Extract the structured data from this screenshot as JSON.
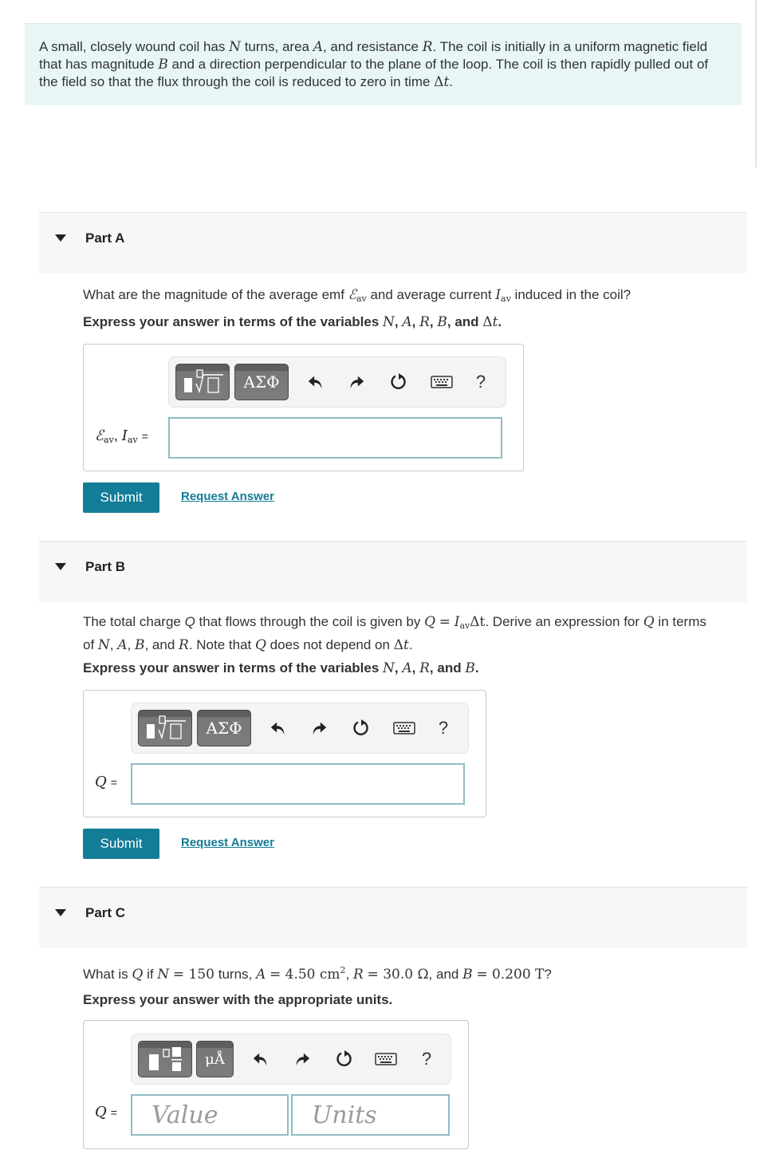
{
  "intro": {
    "text_html": "A small, closely wound coil has <span class=\"math\">N</span> turns, area <span class=\"math\">A</span>, and resistance <span class=\"math\">R</span>. The coil is initially in a uniform magnetic field that has magnitude <span class=\"math\">B</span> and a direction perpendicular to the plane of the loop. The coil is then rapidly pulled out of the field so that the flux through the coil is reduced to zero in time <span class=\"mathr\">&Delta;</span><span class=\"math\">t</span>."
  },
  "parts": [
    {
      "title": "Part A",
      "question_html": "What are the magnitude of the average emf <span class=\"math\">&#8496;</span><sub class=\"ms\">av</sub> and average current <span class=\"math\">I</span><sub class=\"ms\">av</sub> induced in the coil?",
      "instruction_html": "Express your answer in terms of the variables <span class=\"math\" style=\"font-weight:normal\">N</span>, <span class=\"math\" style=\"font-weight:normal\">A</span>, <span class=\"math\" style=\"font-weight:normal\">R</span>, <span class=\"math\" style=\"font-weight:normal\">B</span>, and <span class=\"mathr\" style=\"font-weight:normal\">&Delta;</span><span class=\"math\" style=\"font-weight:normal\">t</span>.",
      "answer_label_html": "<span class=\"math\">&#8496;</span><sub class=\"ms\">av</sub>, <span class=\"math\">I</span><sub class=\"ms\">av</sub> <span style=\"font-family:'Liberation Sans',sans-serif;font-size:14px\">=</span>",
      "answer_value": "",
      "toolbar": {
        "template_button": "templates",
        "greek_button": "ΑΣΦ",
        "undo": "undo",
        "redo": "redo",
        "reset": "reset",
        "keyboard": "keyboard",
        "help": "?"
      },
      "submit_label": "Submit",
      "request_answer_label": "Request Answer"
    },
    {
      "title": "Part B",
      "question_html": "The total charge <i>Q</i> that flows through the coil is given by <span class=\"math\">Q</span> <span class=\"mathr\">=</span> <span class=\"math\">I</span><sub class=\"ms\">av</sub><span class=\"mathr\">&Delta;t</span>. Derive an expression for <span class=\"math\">Q</span> in terms of <span class=\"math\">N</span>, <span class=\"math\">A</span>, <span class=\"math\">B</span>, and <span class=\"math\">R</span>. Note that <span class=\"math\">Q</span> does not depend on <span class=\"mathr\">&Delta;</span><span class=\"math\">t</span>.",
      "instruction_html": "Express your answer in terms of the variables <span class=\"math\" style=\"font-weight:normal\">N</span>, <span class=\"math\" style=\"font-weight:normal\">A</span>, <span class=\"math\" style=\"font-weight:normal\">R</span>, and <span class=\"math\" style=\"font-weight:normal\">B</span>.",
      "answer_label_html": "<span class=\"math\">Q</span> <span style=\"font-family:'Liberation Sans',sans-serif;font-size:14px\">=</span>",
      "answer_value": "",
      "toolbar": {
        "template_button": "templates",
        "greek_button": "ΑΣΦ",
        "undo": "undo",
        "redo": "redo",
        "reset": "reset",
        "keyboard": "keyboard",
        "help": "?"
      },
      "submit_label": "Submit",
      "request_answer_label": "Request Answer"
    },
    {
      "title": "Part C",
      "question_html": "What is <span class=\"math\">Q</span> if <span class=\"math\">N</span> <span class=\"mathr\">= 150</span> turns, <span class=\"math\">A</span> <span class=\"mathr\">= 4.50 cm</span><sup class=\"ms\">2</sup>, <span class=\"math\">R</span> <span class=\"mathr\">= 30.0 &Omega;</span>, and <span class=\"math\">B</span> <span class=\"mathr\">= 0.200 T</span>?",
      "instruction": "Express your answer with the appropriate units.",
      "answer_label_html": "<span class=\"math\">Q</span> <span style=\"font-family:'Liberation Sans',sans-serif;font-size:14px\">=</span>",
      "value_placeholder": "Value",
      "units_placeholder": "Units",
      "toolbar": {
        "template_button": "templates",
        "units_button": "μÅ",
        "undo": "undo",
        "redo": "redo",
        "reset": "reset",
        "keyboard": "keyboard",
        "help": "?"
      }
    }
  ],
  "colors": {
    "accent": "#137c97",
    "intro_bg": "#e8f6f6",
    "part_header_bg": "#f7f7f7",
    "input_border": "#8fbcc4"
  }
}
